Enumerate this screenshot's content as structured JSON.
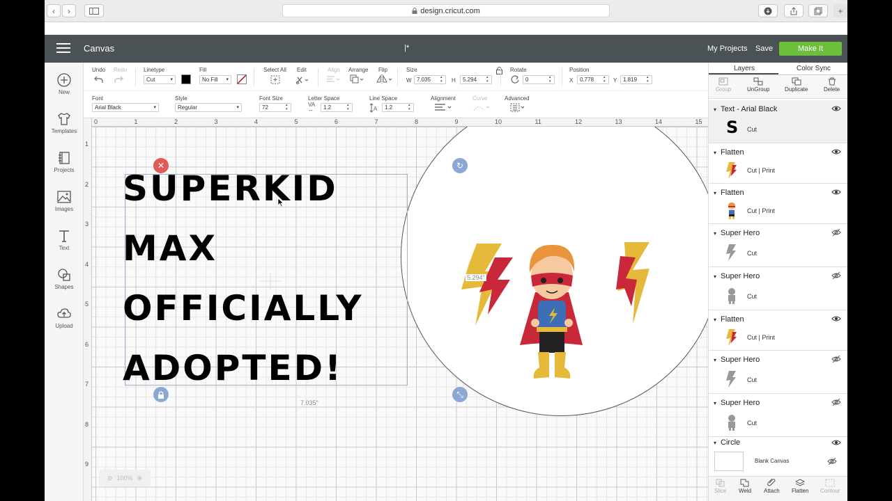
{
  "browser": {
    "url": "design.cricut.com"
  },
  "header": {
    "app_title": "Canvas",
    "doc_title": "|*",
    "my_projects": "My Projects",
    "save": "Save",
    "make_it": "Make It"
  },
  "rail": {
    "items": [
      {
        "label": "New",
        "icon": "plus-circle-icon"
      },
      {
        "label": "Templates",
        "icon": "shirt-icon"
      },
      {
        "label": "Projects",
        "icon": "notebook-icon"
      },
      {
        "label": "Images",
        "icon": "image-icon"
      },
      {
        "label": "Text",
        "icon": "text-icon"
      },
      {
        "label": "Shapes",
        "icon": "shapes-icon"
      },
      {
        "label": "Upload",
        "icon": "cloud-upload-icon"
      }
    ]
  },
  "toolbar": {
    "undo": "Undo",
    "redo": "Redo",
    "linetype_label": "Linetype",
    "linetype_value": "Cut",
    "fill_label": "Fill",
    "fill_value": "No Fill",
    "select_all": "Select All",
    "edit": "Edit",
    "align": "Align",
    "arrange": "Arrange",
    "flip": "Flip",
    "size_label": "Size",
    "w_label": "W",
    "w_value": "7.035",
    "h_label": "H",
    "h_value": "5.294",
    "rotate_label": "Rotate",
    "rotate_value": "0",
    "position_label": "Position",
    "x_label": "X",
    "x_value": "0.778",
    "y_label": "Y",
    "y_value": "1.819",
    "font_label": "Font",
    "font_value": "Arial Black",
    "style_label": "Style",
    "style_value": "Regular",
    "fontsize_label": "Font Size",
    "fontsize_value": "72",
    "letterspace_label": "Letter Space",
    "letterspace_value": "1.2",
    "linespace_label": "Line Space",
    "linespace_value": "1.2",
    "alignment_label": "Alignment",
    "curve_label": "Curve",
    "advanced_label": "Advanced"
  },
  "canvas": {
    "ruler_h": [
      "0",
      "1",
      "2",
      "3",
      "4",
      "5",
      "6",
      "7",
      "8",
      "9",
      "10",
      "11",
      "12",
      "13",
      "14",
      "15"
    ],
    "ruler_v": [
      "1",
      "2",
      "3",
      "4",
      "5",
      "6",
      "7",
      "8",
      "9"
    ],
    "text_lines": [
      "SUPERKID",
      "MAX",
      "OFFICIALLY",
      "ADOPTED!"
    ],
    "width_label": "7.035\"",
    "height_label": "5.294\"",
    "zoom": "100%"
  },
  "panel": {
    "tabs": [
      "Layers",
      "Color Sync"
    ],
    "actions": [
      {
        "label": "Group",
        "icon": "group-icon",
        "enabled": false
      },
      {
        "label": "UnGroup",
        "icon": "ungroup-icon",
        "enabled": true
      },
      {
        "label": "Duplicate",
        "icon": "duplicate-icon",
        "enabled": true
      },
      {
        "label": "Delete",
        "icon": "trash-icon",
        "enabled": true
      }
    ],
    "layers": [
      {
        "name": "Text - Arial Black",
        "op": "Cut",
        "visible": true,
        "thumb": "S"
      },
      {
        "name": "Flatten",
        "op": "Cut  |  Print",
        "visible": true,
        "thumb": "bolt"
      },
      {
        "name": "Flatten",
        "op": "Cut  |  Print",
        "visible": true,
        "thumb": "kid"
      },
      {
        "name": "Super Hero",
        "op": "Cut",
        "visible": false,
        "thumb": "grey"
      },
      {
        "name": "Super Hero",
        "op": "Cut",
        "visible": false,
        "thumb": "grey2"
      },
      {
        "name": "Flatten",
        "op": "Cut  |  Print",
        "visible": true,
        "thumb": "bolt"
      },
      {
        "name": "Super Hero",
        "op": "Cut",
        "visible": false,
        "thumb": "grey"
      },
      {
        "name": "Super Hero",
        "op": "Cut",
        "visible": false,
        "thumb": "grey2"
      },
      {
        "name": "Circle",
        "op": "",
        "visible": true,
        "thumb": ""
      }
    ],
    "blank_canvas": "Blank Canvas",
    "bottom_actions": [
      {
        "label": "Slice",
        "enabled": false
      },
      {
        "label": "Weld",
        "enabled": true
      },
      {
        "label": "Attach",
        "enabled": true
      },
      {
        "label": "Flatten",
        "enabled": true
      },
      {
        "label": "Contour",
        "enabled": false
      }
    ]
  }
}
